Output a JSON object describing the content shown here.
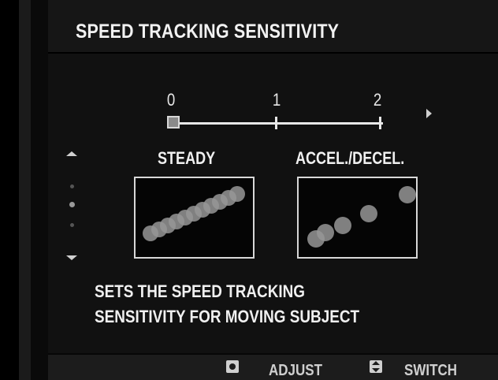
{
  "header": {
    "title": "SPEED TRACKING SENSITIVITY"
  },
  "scale": {
    "labels": [
      "0",
      "1",
      "2"
    ],
    "selected": "0"
  },
  "modes": {
    "steady_label": "STEADY",
    "accel_label": "ACCEL./DECEL."
  },
  "description": {
    "line1": "SETS THE SPEED TRACKING",
    "line2": "SENSITIVITY FOR MOVING SUBJECT"
  },
  "footer": {
    "adjust_icon": "dial-icon",
    "adjust_label": "ADJUST",
    "switch_icon": "updown-icon",
    "switch_label": "SWITCH"
  },
  "colors": {
    "background": "#111111",
    "text": "#f0f0f0",
    "accent": "#8a8a8a"
  }
}
